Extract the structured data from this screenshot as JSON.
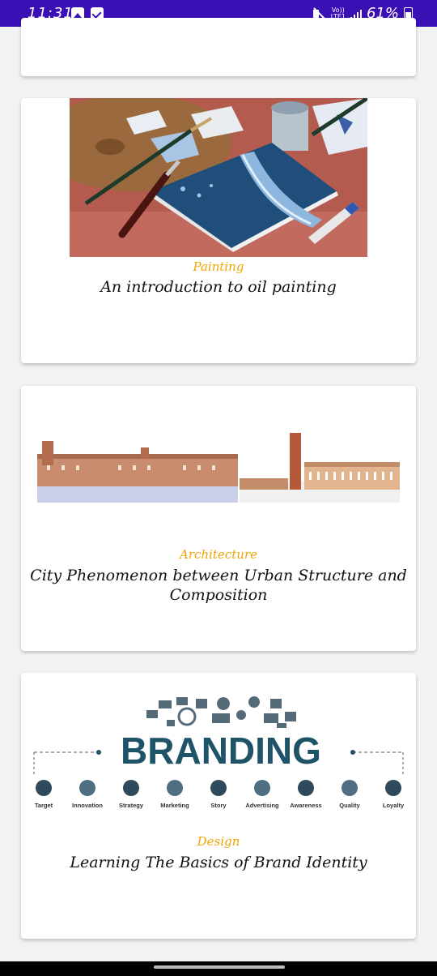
{
  "status_bar": {
    "time": "11:31",
    "network_top": "Vo))",
    "network_bottom": "LTE1",
    "battery": "61%"
  },
  "cards": [
    {
      "category": "Painting",
      "title": "An introduction to oil painting"
    },
    {
      "category": "Architecture",
      "title_line1": "City Phenomenon between Urban Structure and",
      "title_line2": "Composition"
    },
    {
      "category": "Design",
      "title": "Learning The Basics of Brand Identity"
    }
  ],
  "branding_image": {
    "word": "BRANDING",
    "steps": [
      "Target",
      "Innovation",
      "Strategy",
      "Marketing",
      "Story",
      "Advertising",
      "Awareness",
      "Quality",
      "Loyalty"
    ]
  },
  "colors": {
    "status_bar": "#3a10b5",
    "category": "#f0a500",
    "brand_teal": "#1f5368"
  }
}
